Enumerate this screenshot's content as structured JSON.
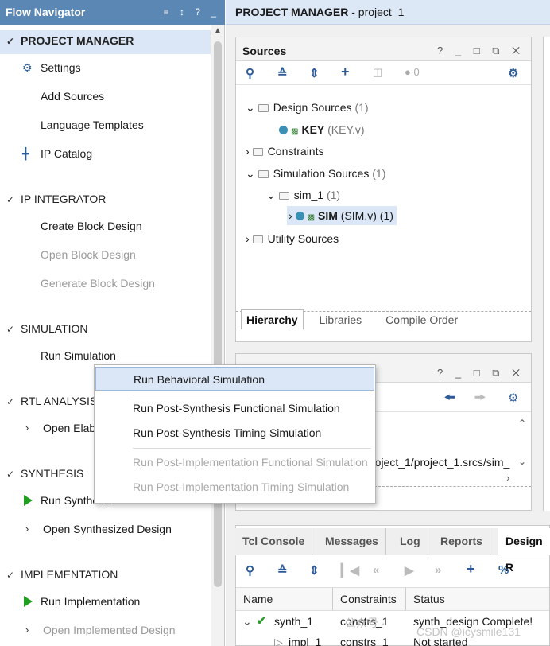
{
  "flow_navigator": {
    "title": "Flow Navigator",
    "controls": "≡ ↕ ? _",
    "sections": {
      "project_manager": {
        "label": "PROJECT MANAGER",
        "items": {
          "settings": "Settings",
          "add_sources": "Add Sources",
          "language_templates": "Language Templates",
          "ip_catalog": "IP Catalog"
        }
      },
      "ip_integrator": {
        "label": "IP INTEGRATOR",
        "items": {
          "create_block_design": "Create Block Design",
          "open_block_design": "Open Block Design",
          "generate_block_design": "Generate Block Design"
        }
      },
      "simulation": {
        "label": "SIMULATION",
        "items": {
          "run_simulation": "Run Simulation"
        }
      },
      "rtl_analysis": {
        "label": "RTL ANALYSIS",
        "items": {
          "open_elaborated": "Open Elab"
        }
      },
      "synthesis": {
        "label": "SYNTHESIS",
        "items": {
          "run_synthesis": "Run Synthesis",
          "open_synthesized": "Open Synthesized Design"
        }
      },
      "implementation": {
        "label": "IMPLEMENTATION",
        "items": {
          "run_implementation": "Run Implementation",
          "open_implemented": "Open Implemented Design"
        }
      }
    }
  },
  "header": {
    "title": "PROJECT MANAGER",
    "project": " - project_1"
  },
  "sources": {
    "title": "Sources",
    "controls": "? _ □ ⧉ ✕",
    "error_count": "0",
    "tree": {
      "design_sources": {
        "label": "Design Sources",
        "count": "(1)"
      },
      "key": {
        "name": "KEY",
        "file": "(KEY.v)"
      },
      "constraints": {
        "label": "Constraints"
      },
      "simulation_sources": {
        "label": "Simulation Sources",
        "count": "(1)"
      },
      "sim_1": {
        "label": "sim_1",
        "count": "(1)"
      },
      "sim": {
        "name": "SIM",
        "file": "(SIM.v) (1)"
      },
      "utility_sources": {
        "label": "Utility Sources"
      }
    },
    "tabs": {
      "hierarchy": "Hierarchy",
      "libraries": "Libraries",
      "compile_order": "Compile Order"
    }
  },
  "properties": {
    "controls": "? _ □ ⧉ ✕",
    "path_text": "roject_1/project_1.srcs/sim_"
  },
  "context_menu": {
    "items": {
      "behavioral": "Run Behavioral Simulation",
      "post_synth_func": "Run Post-Synthesis Functional Simulation",
      "post_synth_timing": "Run Post-Synthesis Timing Simulation",
      "post_impl_func": "Run Post-Implementation Functional Simulation",
      "post_impl_timing": "Run Post-Implementation Timing Simulation"
    }
  },
  "bottom": {
    "tabs": {
      "tcl": "Tcl Console",
      "messages": "Messages",
      "log": "Log",
      "reports": "Reports",
      "design_runs": "Design R"
    },
    "columns": {
      "name": "Name",
      "constraints": "Constraints",
      "status": "Status"
    },
    "rows": {
      "synth": {
        "name": "synth_1",
        "constraints": "constrs_1",
        "status": "synth_design Complete!"
      },
      "impl": {
        "name": "impl_1",
        "constraints": "constrs_1",
        "status": "Not started"
      }
    }
  },
  "watermark": {
    "wechat": "公众号 ·",
    "csdn": "CSDN @icysmile131"
  },
  "colors": {
    "title_bar": "#5b87b5",
    "selection": "#dbe7f6",
    "run_green": "#1fa01f",
    "toolbar_blue": "#2d5b97"
  }
}
